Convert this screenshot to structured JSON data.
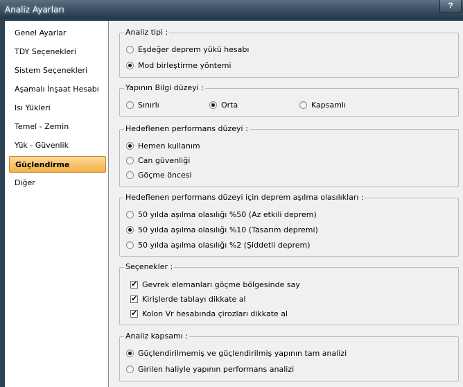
{
  "window": {
    "title": "Analiz Ayarları",
    "help_label": "?"
  },
  "sidebar": {
    "items": [
      {
        "label": "Genel Ayarlar",
        "active": false
      },
      {
        "label": "TDY Seçenekleri",
        "active": false
      },
      {
        "label": "Sistem Seçenekleri",
        "active": false
      },
      {
        "label": "Aşamalı İnşaat Hesabı",
        "active": false
      },
      {
        "label": "Isı Yükleri",
        "active": false
      },
      {
        "label": "Temel - Zemin",
        "active": false
      },
      {
        "label": "Yük - Güvenlik",
        "active": false
      },
      {
        "label": "Güçlendirme",
        "active": true
      },
      {
        "label": "Diğer",
        "active": false
      }
    ]
  },
  "groups": {
    "analiz_tipi": {
      "legend": "Analiz tipi :",
      "options": [
        {
          "label": "Eşdeğer deprem yükü hesabı",
          "checked": false
        },
        {
          "label": "Mod birleştirme yöntemi",
          "checked": true
        }
      ]
    },
    "bilgi_duzeyi": {
      "legend": "Yapının Bilgi düzeyi :",
      "options": [
        {
          "label": "Sınırlı",
          "checked": false
        },
        {
          "label": "Orta",
          "checked": true
        },
        {
          "label": "Kapsamlı",
          "checked": false
        }
      ]
    },
    "performans": {
      "legend": "Hedeflenen performans düzeyi :",
      "options": [
        {
          "label": "Hemen kullanım",
          "checked": true
        },
        {
          "label": "Can güvenliği",
          "checked": false
        },
        {
          "label": "Göçme öncesi",
          "checked": false
        }
      ]
    },
    "asilma": {
      "legend": "Hedeflenen performans düzeyi için deprem aşılma olasılıkları :",
      "options": [
        {
          "label": "50 yılda aşılma olasılığı %50 (Az etkili deprem)",
          "checked": false
        },
        {
          "label": "50 yılda aşılma olasılığı %10 (Tasarım depremi)",
          "checked": true
        },
        {
          "label": "50 yılda aşılma olasılığı %2  (Şiddetli deprem)",
          "checked": false
        }
      ]
    },
    "secenekler": {
      "legend": "Seçenekler :",
      "options": [
        {
          "label": "Gevrek elemanları göçme bölgesinde say",
          "checked": true
        },
        {
          "label": "Kirişlerde tablayı dikkate al",
          "checked": true
        },
        {
          "label": "Kolon Vr hesabında çirozları dikkate al",
          "checked": true
        }
      ]
    },
    "kapsam": {
      "legend": "Analiz kapsamı :",
      "options": [
        {
          "label": "Güçlendirilmemiş ve güçlendirilmiş yapının tam analizi",
          "checked": true
        },
        {
          "label": "Girilen haliyle yapının performans analizi",
          "checked": false
        }
      ]
    }
  }
}
